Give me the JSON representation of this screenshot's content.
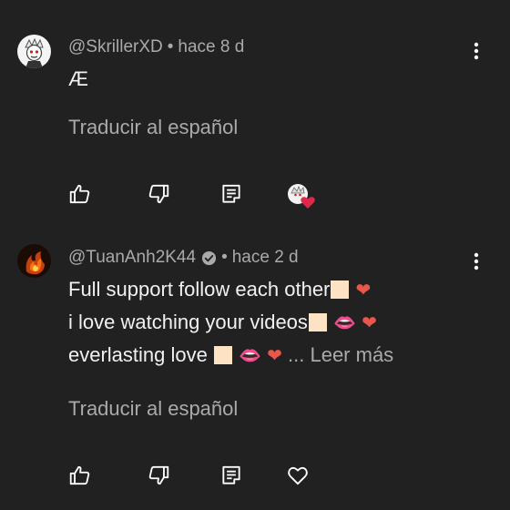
{
  "comments": [
    {
      "author": "@SkrillerXD",
      "sep": "•",
      "time": "hace 8 d",
      "lines": [
        "Æ"
      ],
      "translate": "Traducir al español",
      "verified": false,
      "creator_heart": true
    },
    {
      "author": "@TuanAnh2K44",
      "sep": "•",
      "time": "hace 2 d",
      "lines": [
        "Full support follow each other",
        "i love watching your videos",
        "everlasting love "
      ],
      "more": "... Leer más",
      "translate": "Traducir al español",
      "verified": true,
      "creator_heart": false
    }
  ],
  "icons": {
    "like": "thumbs-up-icon",
    "dislike": "thumbs-down-icon",
    "reply": "reply-icon",
    "heart": "heart-outline-icon",
    "menu": "more-vert-icon"
  },
  "colors": {
    "background": "#212121",
    "secondary_text": "#aaaaaa",
    "primary_text": "#f1f1f1",
    "heart": "#e0284b"
  }
}
